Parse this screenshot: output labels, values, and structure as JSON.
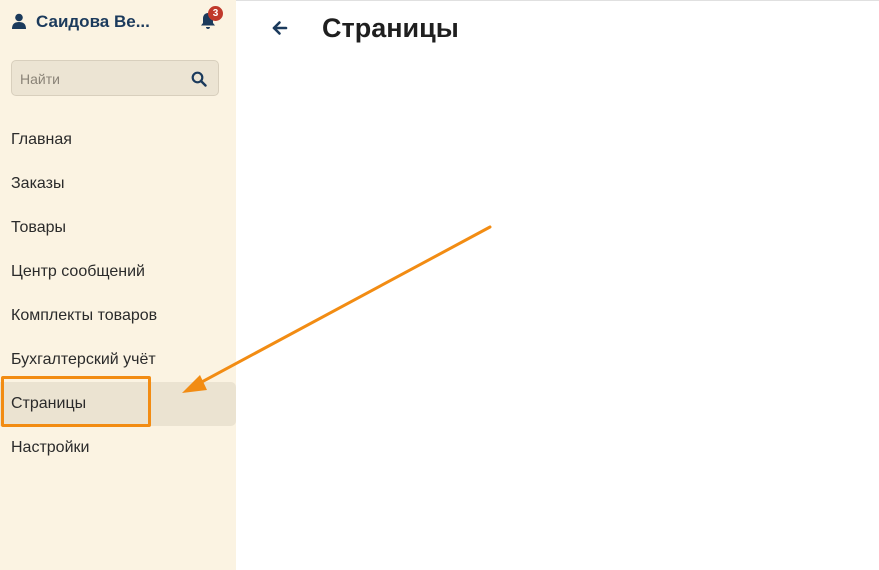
{
  "user": {
    "name": "Саидова Ве...",
    "icon": "user-icon"
  },
  "notifications": {
    "count": "3",
    "icon": "bell-icon",
    "badge_color": "#c0392b"
  },
  "search": {
    "placeholder": "Найти",
    "value": "",
    "icon": "search-icon"
  },
  "sidebar": {
    "items": [
      {
        "label": "Главная",
        "active": false
      },
      {
        "label": "Заказы",
        "active": false
      },
      {
        "label": "Товары",
        "active": false
      },
      {
        "label": "Центр сообщений",
        "active": false
      },
      {
        "label": "Комплекты товаров",
        "active": false
      },
      {
        "label": "Бухгалтерский учёт",
        "active": false
      },
      {
        "label": "Страницы",
        "active": true
      },
      {
        "label": "Настройки",
        "active": false
      }
    ]
  },
  "header": {
    "title": "Страницы",
    "back_icon": "arrow-left-icon"
  },
  "colors": {
    "sidebar_bg": "#fbf3e2",
    "brand_text": "#1b3a5c",
    "active_item_bg": "#ebe3d1",
    "annotation": "#f28c13"
  }
}
